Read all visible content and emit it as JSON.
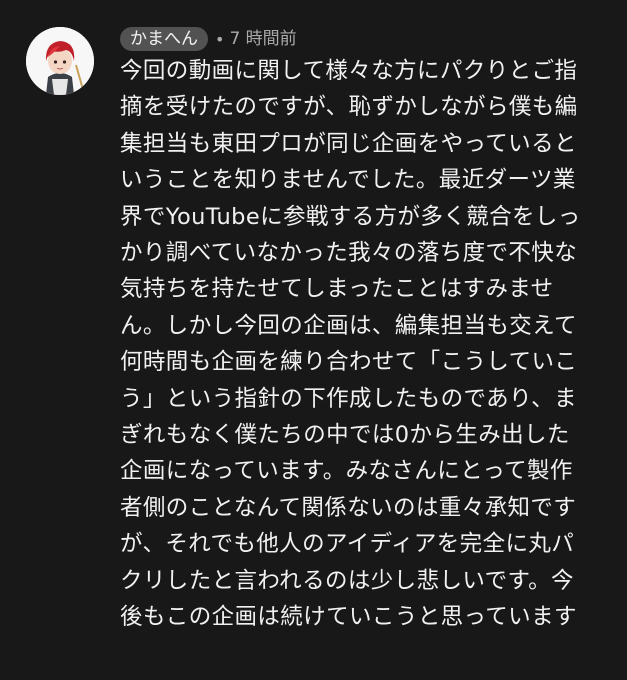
{
  "comment": {
    "author": "かまへん",
    "separator": "•",
    "timestamp": "7 時間前",
    "avatar_icon": "cartoon-avatar-red-hair",
    "text_lines": [
      "今回の動画に関して様々な方にパクりとご指",
      "摘を受けたのですが、恥ずかしながら僕も編",
      "集担当も東田プロが同じ企画をやっていると",
      "いうことを知りませんでした。最近ダーツ業",
      "界でYouTubeに参戦する方が多く競合をしっ",
      "かり調べていなかった我々の落ち度で不快な",
      "気持ちを持たせてしまったことはすみませ",
      "ん。しかし今回の企画は、編集担当も交えて",
      "何時間も企画を練り合わせて「こうしていこ",
      "う」という指針の下作成したものであり、ま",
      "ぎれもなく僕たちの中では0から生み出した",
      "企画になっています。みなさんにとって製作",
      "者側のことなんて関係ないのは重々承知です",
      "が、それでも他人のアイディアを完全に丸パ",
      "クリしたと言われるのは少し悲しいです。今",
      "後もこの企画は続けていこうと思っています"
    ]
  },
  "colors": {
    "background": "#181818",
    "text": "#f1f1f1",
    "chip": "#525252",
    "muted": "#aaaaaa",
    "avatar_hair": "#c0202a",
    "avatar_bg": "#f7f7f7"
  }
}
